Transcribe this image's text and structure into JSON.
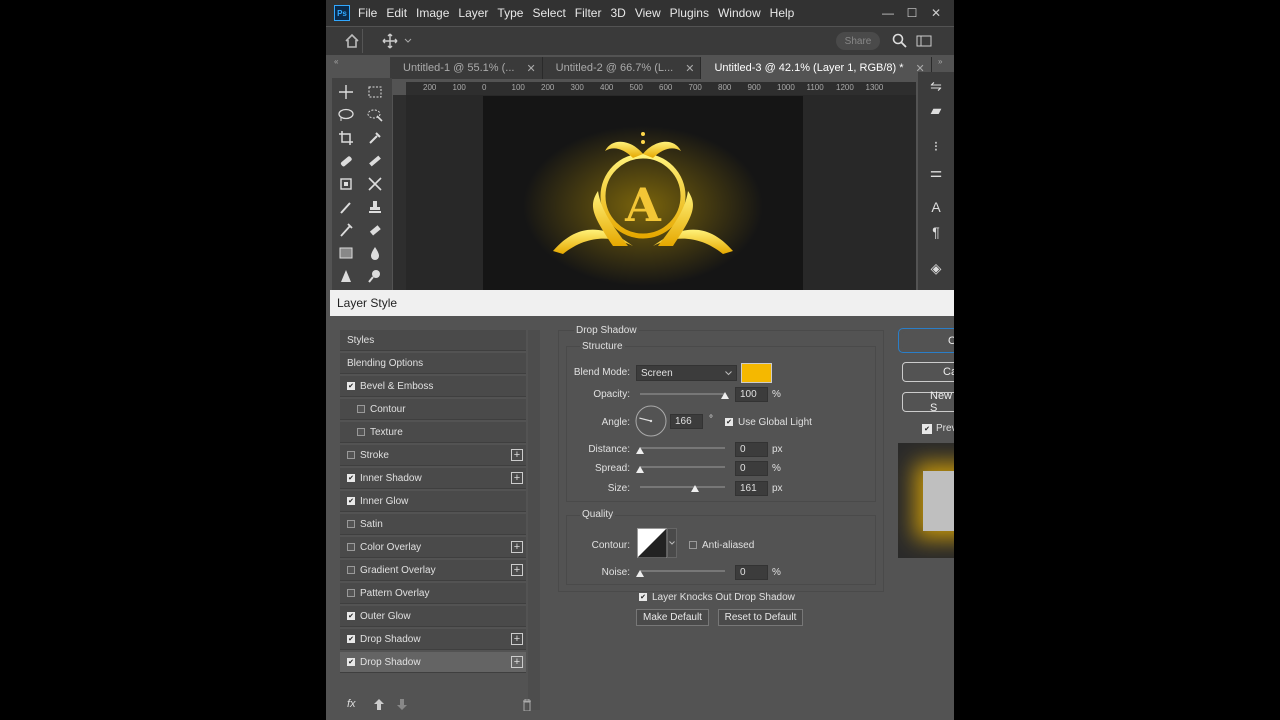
{
  "app": {
    "logo": "Ps"
  },
  "menu": [
    "File",
    "Edit",
    "Image",
    "Layer",
    "Type",
    "Select",
    "Filter",
    "3D",
    "View",
    "Plugins",
    "Window",
    "Help"
  ],
  "window_controls": {
    "minimize": "—",
    "restore": "☐",
    "close": "✕"
  },
  "options_bar": {
    "share_label": "Share"
  },
  "tabs": [
    {
      "label": "Untitled-1 @ 55.1% (..."
    },
    {
      "label": "Untitled-2 @ 66.7% (L..."
    },
    {
      "label": "Untitled-3 @ 42.1% (Layer 1, RGB/8) *"
    }
  ],
  "tab_close": "✕",
  "ruler": {
    "h_labels": [
      "200",
      "100",
      "0",
      "100",
      "200",
      "300",
      "400",
      "500",
      "600",
      "700",
      "800",
      "900",
      "1000",
      "1100",
      "1200",
      "1300"
    ]
  },
  "canvas": {
    "monogram_letter": "A",
    "accent_color": "#f5b800"
  },
  "dialog": {
    "title": "Layer Style",
    "styles_list": [
      {
        "label": "Styles",
        "checkbox": false,
        "checked": false,
        "plus": false,
        "indent": 0
      },
      {
        "label": "Blending Options",
        "checkbox": false,
        "checked": false,
        "plus": false,
        "indent": 0
      },
      {
        "label": "Bevel & Emboss",
        "checkbox": true,
        "checked": true,
        "plus": false,
        "indent": 0
      },
      {
        "label": "Contour",
        "checkbox": true,
        "checked": false,
        "plus": false,
        "indent": 1
      },
      {
        "label": "Texture",
        "checkbox": true,
        "checked": false,
        "plus": false,
        "indent": 1
      },
      {
        "label": "Stroke",
        "checkbox": true,
        "checked": false,
        "plus": true,
        "indent": 0
      },
      {
        "label": "Inner Shadow",
        "checkbox": true,
        "checked": true,
        "plus": true,
        "indent": 0
      },
      {
        "label": "Inner Glow",
        "checkbox": true,
        "checked": true,
        "plus": false,
        "indent": 0
      },
      {
        "label": "Satin",
        "checkbox": true,
        "checked": false,
        "plus": false,
        "indent": 0
      },
      {
        "label": "Color Overlay",
        "checkbox": true,
        "checked": false,
        "plus": true,
        "indent": 0
      },
      {
        "label": "Gradient Overlay",
        "checkbox": true,
        "checked": false,
        "plus": true,
        "indent": 0
      },
      {
        "label": "Pattern Overlay",
        "checkbox": true,
        "checked": false,
        "plus": false,
        "indent": 0
      },
      {
        "label": "Outer Glow",
        "checkbox": true,
        "checked": true,
        "plus": false,
        "indent": 0
      },
      {
        "label": "Drop Shadow",
        "checkbox": true,
        "checked": true,
        "plus": true,
        "indent": 0
      },
      {
        "label": "Drop Shadow",
        "checkbox": true,
        "checked": true,
        "plus": true,
        "indent": 0,
        "selected": true
      }
    ],
    "footer": {
      "fx": "fx"
    },
    "section_title": "Drop Shadow",
    "structure": {
      "title": "Structure",
      "blend_mode_label": "Blend Mode:",
      "blend_mode_value": "Screen",
      "shadow_color": "#f5b800",
      "opacity_label": "Opacity:",
      "opacity_value": "100",
      "opacity_unit": "%",
      "opacity_fraction": 1.0,
      "angle_label": "Angle:",
      "angle_value": "166",
      "angle_unit": "°",
      "use_global_light_label": "Use Global Light",
      "use_global_light_checked": true,
      "distance_label": "Distance:",
      "distance_value": "0",
      "distance_unit": "px",
      "distance_fraction": 0,
      "spread_label": "Spread:",
      "spread_value": "0",
      "spread_unit": "%",
      "spread_fraction": 0,
      "size_label": "Size:",
      "size_value": "161",
      "size_unit": "px",
      "size_fraction": 0.65
    },
    "quality": {
      "title": "Quality",
      "contour_label": "Contour:",
      "anti_aliased_label": "Anti-aliased",
      "anti_aliased_checked": false,
      "noise_label": "Noise:",
      "noise_value": "0",
      "noise_unit": "%",
      "noise_fraction": 0
    },
    "layer_knocks_out_label": "Layer Knocks Out Drop Shadow",
    "layer_knocks_out_checked": true,
    "make_default_label": "Make Default",
    "reset_default_label": "Reset to Default",
    "buttons": {
      "ok": "O",
      "cancel": "Can",
      "new_style": "New S"
    },
    "preview_label": "Prev",
    "preview_checked": true
  }
}
